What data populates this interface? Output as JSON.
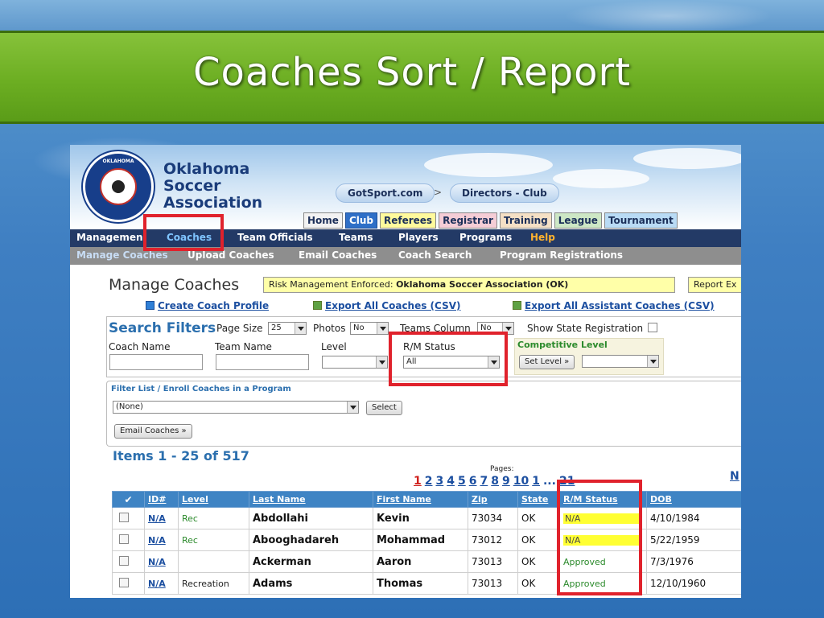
{
  "slide": {
    "title": "Coaches Sort / Report"
  },
  "header": {
    "logo_text": [
      "Oklahoma",
      "Soccer",
      "Association"
    ],
    "logo_ring_text": "OKLAHOMA",
    "breadcrumb": [
      "GotSport.com",
      "Directors - Club"
    ],
    "breadcrumb_sep": ">"
  },
  "top_tabs": [
    "Home",
    "Club",
    "Referees",
    "Registrar",
    "Training",
    "League",
    "Tournament"
  ],
  "nav1": [
    "Managemen",
    "Coaches",
    "Team Officials",
    "Teams",
    "Players",
    "Programs",
    "Help"
  ],
  "nav2": [
    "Manage Coaches",
    "Upload Coaches",
    "Email Coaches",
    "Coach Search",
    "Program Registrations"
  ],
  "page": {
    "title": "Manage Coaches",
    "notice_prefix": "Risk Management Enforced: ",
    "notice_bold": "Oklahoma Soccer Association (OK)",
    "report_btn": "Report Ex",
    "links": {
      "create": "Create Coach Profile",
      "export_all": "Export All Coaches (CSV)",
      "export_assist": "Export All Assistant Coaches (CSV)"
    }
  },
  "filters": {
    "title": "Search Filters",
    "page_size_label": "Page Size",
    "page_size_value": "25",
    "photos_label": "Photos",
    "photos_value": "No",
    "teams_col_label": "Teams Column",
    "teams_col_value": "No",
    "show_state_label": "Show State Registration",
    "coach_name_label": "Coach Name",
    "team_name_label": "Team Name",
    "level_label": "Level",
    "rm_status_label": "R/M Status",
    "rm_status_value": "All",
    "competitive_label": "Competitive Level",
    "set_level_btn": "Set Level »"
  },
  "enroll": {
    "title": "Filter List / Enroll Coaches in a Program",
    "program_value": "(None)",
    "select_btn": "Select",
    "email_btn": "Email Coaches »"
  },
  "results": {
    "items_label": "Items 1 - 25 of 517",
    "pages_label": "Pages:",
    "current_page": "1",
    "pages": [
      "2",
      "3",
      "4",
      "5",
      "6",
      "7",
      "8",
      "9",
      "10",
      "1"
    ],
    "ellipsis": "...",
    "last_page": "21",
    "next_label": "N"
  },
  "table": {
    "columns": [
      "✔",
      "ID#",
      "Level",
      "Last Name",
      "First Name",
      "Zip",
      "State",
      "R/M Status",
      "DOB"
    ],
    "rows": [
      {
        "id": "N/A",
        "level": "Rec",
        "last": "Abdollahi",
        "first": "Kevin",
        "zip": "73034",
        "state": "OK",
        "status": "N/A",
        "dob": "4/10/1984"
      },
      {
        "id": "N/A",
        "level": "Rec",
        "last": "Abooghadareh",
        "first": "Mohammad",
        "zip": "73012",
        "state": "OK",
        "status": "N/A",
        "dob": "5/22/1959"
      },
      {
        "id": "N/A",
        "level": "",
        "last": "Ackerman",
        "first": "Aaron",
        "zip": "73013",
        "state": "OK",
        "status": "Approved",
        "dob": "7/3/1976"
      },
      {
        "id": "N/A",
        "level": "Recreation",
        "last": "Adams",
        "first": "Thomas",
        "zip": "73013",
        "state": "OK",
        "status": "Approved",
        "dob": "12/10/1960"
      }
    ]
  },
  "colors": {
    "title_band": "#6cae22",
    "nav_navy": "#233a66",
    "nav_grey": "#8e8e8e",
    "table_header": "#3f84c4",
    "annotation_red": "#e0222c",
    "highlight_yellow": "#ffff33"
  }
}
